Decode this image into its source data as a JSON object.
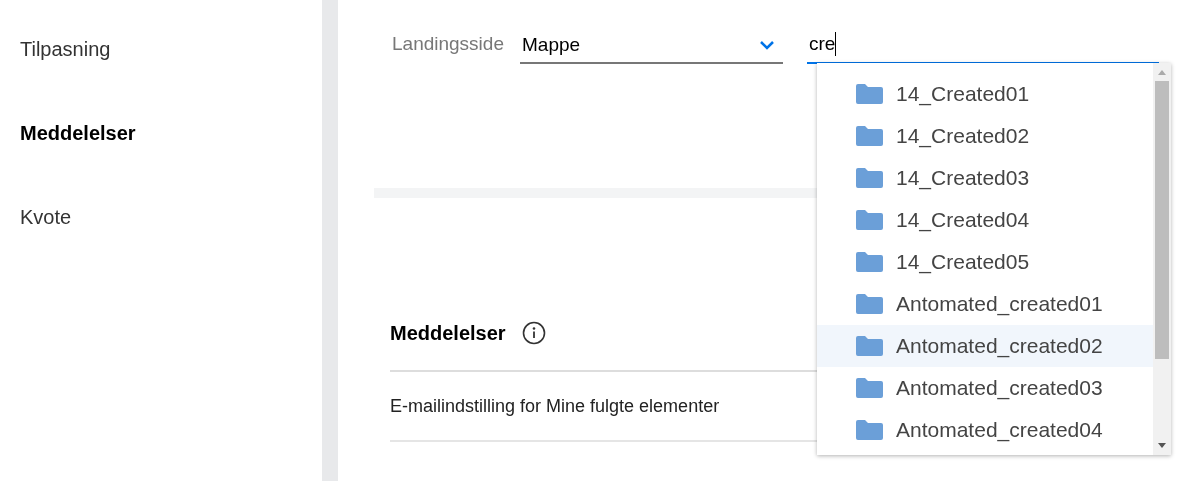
{
  "sidebar": {
    "items": [
      {
        "label": "Tilpasning",
        "selected": false
      },
      {
        "label": "Meddelelser",
        "selected": true
      },
      {
        "label": "Kvote",
        "selected": false
      }
    ]
  },
  "landing": {
    "label": "Landingsside",
    "select_value": "Mappe",
    "search_value": "cre"
  },
  "dropdown": {
    "items": [
      {
        "label": "14_Created01",
        "selected": false
      },
      {
        "label": "14_Created02",
        "selected": false
      },
      {
        "label": "14_Created03",
        "selected": false
      },
      {
        "label": "14_Created04",
        "selected": false
      },
      {
        "label": "14_Created05",
        "selected": false
      },
      {
        "label": "Antomated_created01",
        "selected": false
      },
      {
        "label": "Antomated_created02",
        "selected": true
      },
      {
        "label": "Antomated_created03",
        "selected": false
      },
      {
        "label": "Antomated_created04",
        "selected": false
      }
    ]
  },
  "notifications": {
    "title": "Meddelelser",
    "rows": [
      "E-mailindstilling for Mine fulgte elementer"
    ]
  }
}
